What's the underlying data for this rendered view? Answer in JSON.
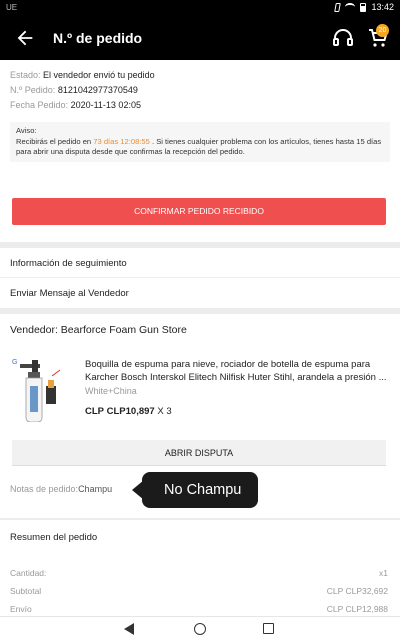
{
  "status_bar": {
    "carrier": "UE",
    "time": "13:42"
  },
  "header": {
    "title": "N.º de pedido",
    "cart_count": "20"
  },
  "order": {
    "status_label": "Estado:",
    "status_value": "El vendedor envió tu pedido",
    "number_label": "N.º Pedido:",
    "number_value": "8121042977370549",
    "date_label": "Fecha Pedido:",
    "date_value": "2020-11-13 02:05"
  },
  "notice": {
    "title": "Aviso:",
    "text_before": "Recibirás el pedido en ",
    "highlight": "73 días 12:08:55",
    "text_after": " . Si tienes cualquier problema con los artículos, tienes hasta 15 días para abrir una disputa desde que confirmas la recepción del pedido."
  },
  "confirm_button": "CONFIRMAR PEDIDO RECIBIDO",
  "links": {
    "tracking": "Información de seguimiento",
    "message_seller": "Enviar Mensaje al Vendedor"
  },
  "seller": {
    "label": "Vendedor: Bearforce Foam Gun Store"
  },
  "product": {
    "title": "Boquilla de espuma para nieve, rociador de botella de espuma para Karcher Bosch Interskol Elitech Nilfisk Huter Stihl, arandela a presión ...",
    "variant": "White+China",
    "currency": "CLP",
    "price": "CLP10,897",
    "quantity": "X 3"
  },
  "dispute_button": "ABRIR DISPUTA",
  "notes": {
    "label": "Notas de pedido:",
    "value": "Champu"
  },
  "toast": {
    "text": "No Champu"
  },
  "summary": {
    "title": "Resumen del pedido",
    "rows": [
      {
        "label": "Cantidad:",
        "value": "x1"
      },
      {
        "label": "Subtotal",
        "value": "CLP CLP32,692"
      },
      {
        "label": "Envío",
        "value": "CLP CLP12,988"
      }
    ]
  },
  "colors": {
    "accent": "#f04f4f",
    "highlight": "#f08a24",
    "header_bg": "#000000"
  }
}
